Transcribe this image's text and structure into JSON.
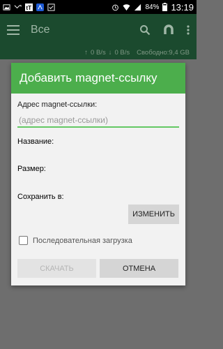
{
  "status_bar": {
    "battery": "84%",
    "time": "13:19"
  },
  "app_bar": {
    "title": "Все",
    "icons": [
      "menu-icon",
      "search-icon",
      "magnet-icon",
      "more-vert-icon"
    ]
  },
  "info_bar": {
    "upload_speed": "0 B/s",
    "download_speed": "0 B/s",
    "free_space": "Свободно:9,4 GB"
  },
  "dialog": {
    "title": "Добавить magnet-ссылку",
    "address_label": "Адрес magnet-ссылки:",
    "address_placeholder": "(адрес magnet-ссылки)",
    "name_label": "Название:",
    "size_label": "Размер:",
    "save_to_label": "Сохранить в:",
    "change_button": "ИЗМЕНИТЬ",
    "sequential_label": "Последовательная загрузка",
    "download_button": "СКАЧАТЬ",
    "cancel_button": "ОТМЕНА"
  },
  "colors": {
    "accent": "#4cae4c",
    "app_bar": "#1b4a2e"
  }
}
